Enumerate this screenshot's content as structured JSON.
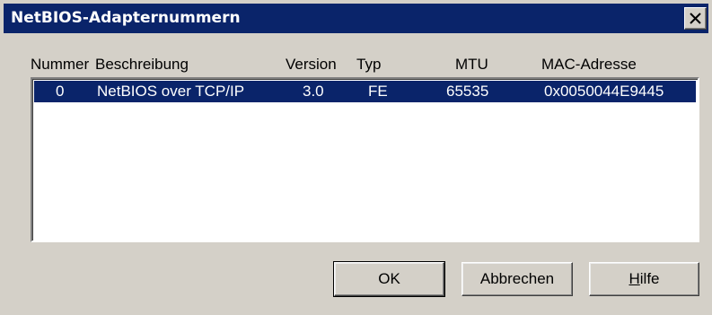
{
  "window": {
    "title": "NetBIOS-Adapternummern"
  },
  "columns": {
    "nummer": "Nummer",
    "beschreibung": "Beschreibung",
    "version": "Version",
    "typ": "Typ",
    "mtu": "MTU",
    "mac": "MAC-Adresse"
  },
  "rows": [
    {
      "nummer": "0",
      "beschreibung": "NetBIOS over TCP/IP",
      "version": "3.0",
      "typ": "FE",
      "mtu": "65535",
      "mac": "0x0050044E9445",
      "selected": true
    }
  ],
  "buttons": {
    "ok": "OK",
    "cancel": "Abbrechen",
    "help_access": "H",
    "help_rest": "ilfe"
  },
  "colors": {
    "title_bar": "#0a246a",
    "selection": "#0a246a",
    "face": "#d4d0c8"
  },
  "icons": {
    "close": "close-icon"
  }
}
